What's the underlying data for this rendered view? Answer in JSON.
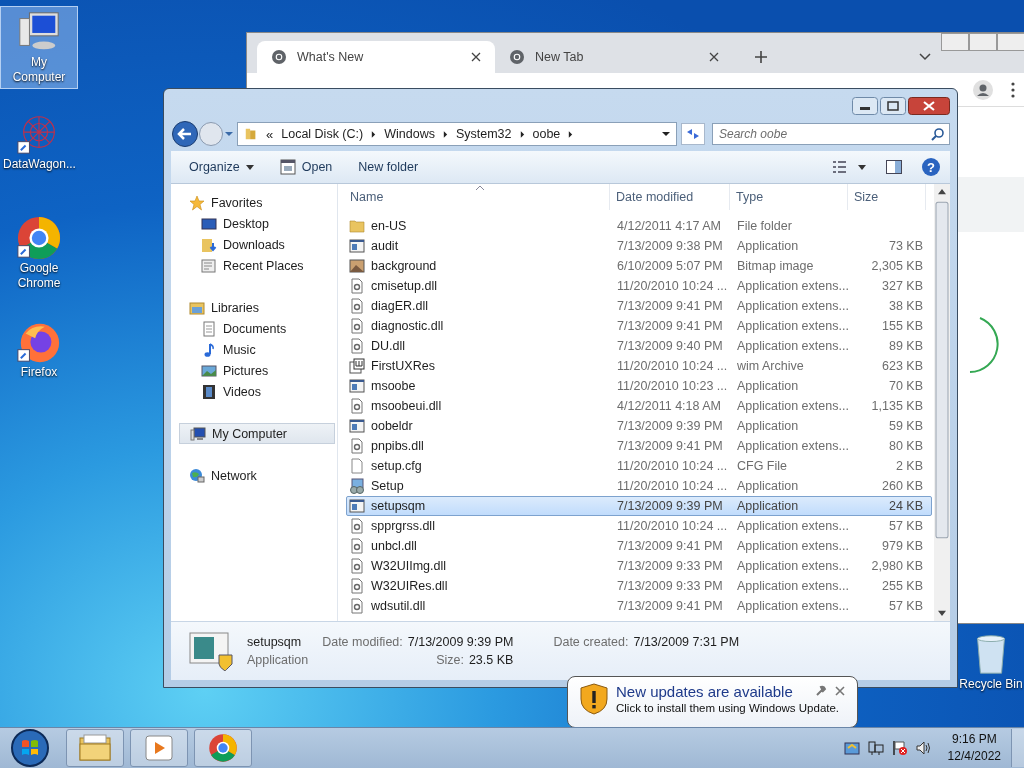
{
  "desktop_icons": [
    {
      "kind": "computer",
      "label": "My Computer",
      "selected": true
    },
    {
      "kind": "network-graph",
      "label": "DataWagon...",
      "selected": false
    },
    {
      "kind": "chrome",
      "label": "Google Chrome",
      "selected": false
    },
    {
      "kind": "firefox",
      "label": "Firefox",
      "selected": false
    }
  ],
  "recycle_bin": {
    "label": "Recycle Bin"
  },
  "browser": {
    "tabs": [
      {
        "label": "What's New",
        "selected": true
      },
      {
        "label": "New Tab",
        "selected": false
      }
    ]
  },
  "explorer": {
    "breadcrumb": [
      "Local Disk (C:)",
      "Windows",
      "System32",
      "oobe"
    ],
    "address_prefix": "«",
    "help": "?",
    "search": {
      "placeholder": "Search oobe"
    },
    "toolbar": [
      {
        "kind": "menu",
        "label": "Organize"
      },
      {
        "kind": "open",
        "label": "Open"
      },
      {
        "kind": "plain",
        "label": "New folder"
      }
    ],
    "nav": [
      {
        "kind": "favorites",
        "label": "Favorites",
        "selected": false,
        "children": [
          {
            "kind": "desktop",
            "label": "Desktop",
            "selected": false
          },
          {
            "kind": "downloads",
            "label": "Downloads",
            "selected": false
          },
          {
            "kind": "recent",
            "label": "Recent Places",
            "selected": false
          }
        ]
      },
      {
        "kind": "libraries",
        "label": "Libraries",
        "selected": false,
        "children": [
          {
            "kind": "documents",
            "label": "Documents",
            "selected": false
          },
          {
            "kind": "music",
            "label": "Music",
            "selected": false
          },
          {
            "kind": "pictures",
            "label": "Pictures",
            "selected": false
          },
          {
            "kind": "videos",
            "label": "Videos",
            "selected": false
          }
        ]
      },
      {
        "kind": "computer",
        "label": "My Computer",
        "selected": true
      },
      {
        "kind": "network",
        "label": "Network",
        "selected": false
      }
    ],
    "columns": [
      "Name",
      "Date modified",
      "Type",
      "Size"
    ],
    "rows": [
      {
        "kind": "folder",
        "name": "en-US",
        "date": "4/12/2011 4:17 AM",
        "type": "File folder",
        "size": "",
        "selected": false
      },
      {
        "kind": "app",
        "name": "audit",
        "date": "7/13/2009 9:38 PM",
        "type": "Application",
        "size": "73 KB",
        "selected": false
      },
      {
        "kind": "image",
        "name": "background",
        "date": "6/10/2009 5:07 PM",
        "type": "Bitmap image",
        "size": "2,305 KB",
        "selected": false
      },
      {
        "kind": "dll",
        "name": "cmisetup.dll",
        "date": "11/20/2010 10:24 ...",
        "type": "Application extens...",
        "size": "327 KB",
        "selected": false
      },
      {
        "kind": "dll",
        "name": "diagER.dll",
        "date": "7/13/2009 9:41 PM",
        "type": "Application extens...",
        "size": "38 KB",
        "selected": false
      },
      {
        "kind": "dll",
        "name": "diagnostic.dll",
        "date": "7/13/2009 9:41 PM",
        "type": "Application extens...",
        "size": "155 KB",
        "selected": false
      },
      {
        "kind": "dll",
        "name": "DU.dll",
        "date": "7/13/2009 9:40 PM",
        "type": "Application extens...",
        "size": "89 KB",
        "selected": false
      },
      {
        "kind": "wim",
        "name": "FirstUXRes",
        "date": "11/20/2010 10:24 ...",
        "type": "wim Archive",
        "size": "623 KB",
        "selected": false
      },
      {
        "kind": "app",
        "name": "msoobe",
        "date": "11/20/2010 10:23 ...",
        "type": "Application",
        "size": "70 KB",
        "selected": false
      },
      {
        "kind": "dll",
        "name": "msoobeui.dll",
        "date": "4/12/2011 4:18 AM",
        "type": "Application extens...",
        "size": "1,135 KB",
        "selected": false
      },
      {
        "kind": "app",
        "name": "oobeldr",
        "date": "7/13/2009 9:39 PM",
        "type": "Application",
        "size": "59 KB",
        "selected": false
      },
      {
        "kind": "dll",
        "name": "pnpibs.dll",
        "date": "7/13/2009 9:41 PM",
        "type": "Application extens...",
        "size": "80 KB",
        "selected": false
      },
      {
        "kind": "file",
        "name": "setup.cfg",
        "date": "11/20/2010 10:24 ...",
        "type": "CFG File",
        "size": "2 KB",
        "selected": false
      },
      {
        "kind": "setup",
        "name": "Setup",
        "date": "11/20/2010 10:24 ...",
        "type": "Application",
        "size": "260 KB",
        "selected": false
      },
      {
        "kind": "app",
        "name": "setupsqm",
        "date": "7/13/2009 9:39 PM",
        "type": "Application",
        "size": "24 KB",
        "selected": true
      },
      {
        "kind": "dll",
        "name": "spprgrss.dll",
        "date": "11/20/2010 10:24 ...",
        "type": "Application extens...",
        "size": "57 KB",
        "selected": false
      },
      {
        "kind": "dll",
        "name": "unbcl.dll",
        "date": "7/13/2009 9:41 PM",
        "type": "Application extens...",
        "size": "979 KB",
        "selected": false
      },
      {
        "kind": "dll",
        "name": "W32UIImg.dll",
        "date": "7/13/2009 9:33 PM",
        "type": "Application extens...",
        "size": "2,980 KB",
        "selected": false
      },
      {
        "kind": "dll",
        "name": "W32UIRes.dll",
        "date": "7/13/2009 9:33 PM",
        "type": "Application extens...",
        "size": "255 KB",
        "selected": false
      },
      {
        "kind": "dll",
        "name": "wdsutil.dll",
        "date": "7/13/2009 9:41 PM",
        "type": "Application extens...",
        "size": "57 KB",
        "selected": false
      }
    ],
    "details": {
      "name": "setupsqm",
      "type": "Application",
      "fields": [
        {
          "label": "Date modified:",
          "value": "7/13/2009 9:39 PM"
        },
        {
          "label": "Date created:",
          "value": "7/13/2009 7:31 PM"
        },
        {
          "label": "Size:",
          "value": "23.5 KB"
        }
      ]
    }
  },
  "notification": {
    "title": "New updates are available",
    "text": "Click to install them using Windows Update."
  },
  "clock": {
    "time": "9:16 PM",
    "date": "12/4/2022"
  }
}
